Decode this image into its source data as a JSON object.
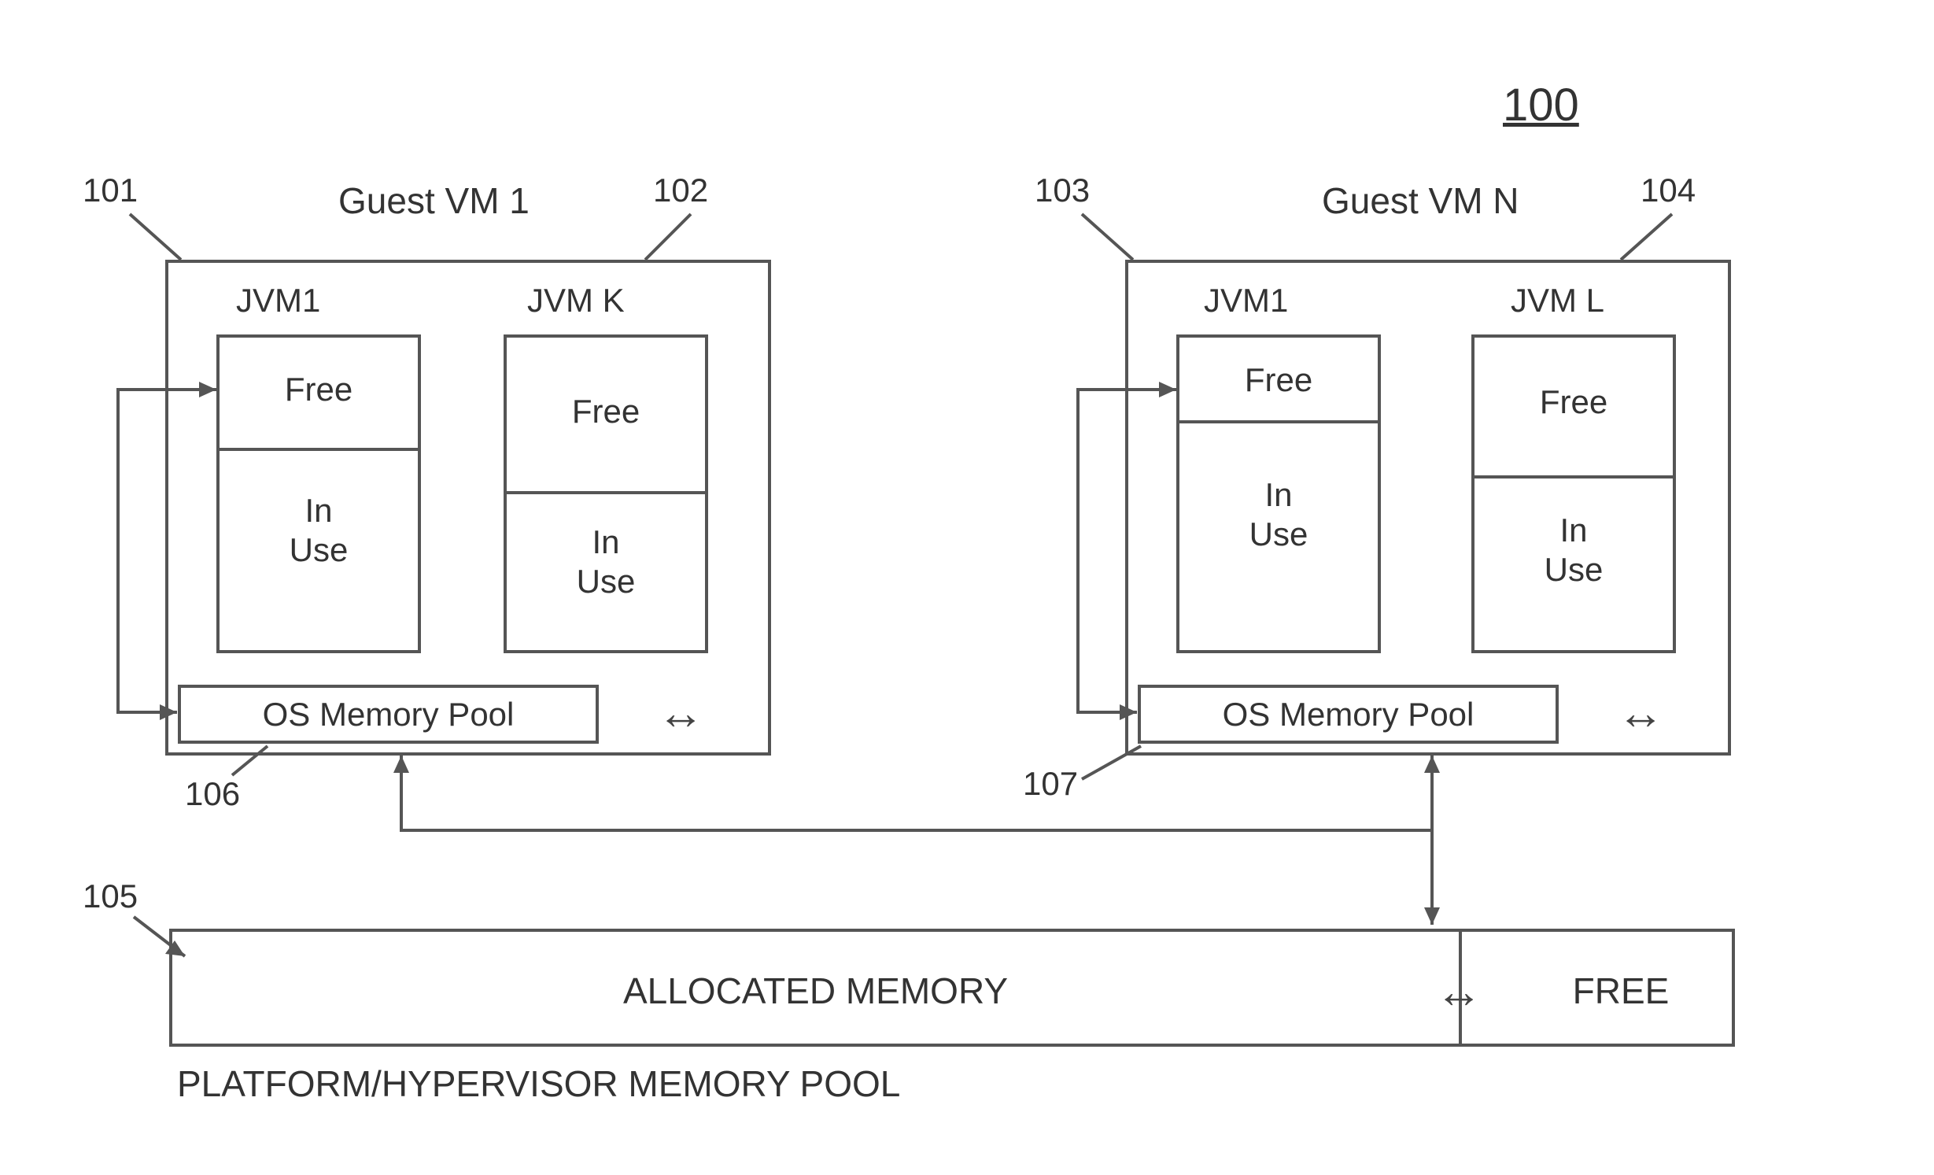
{
  "figure_number": "100",
  "vm1": {
    "title": "Guest VM 1",
    "ref_left": "101",
    "ref_right": "102",
    "jvm_a": {
      "label": "JVM1",
      "free": "Free",
      "inuse": "In\nUse"
    },
    "jvm_b": {
      "label": "JVM K",
      "free": "Free",
      "inuse": "In\nUse"
    },
    "os_pool": "OS Memory Pool",
    "os_ref": "106"
  },
  "vmN": {
    "title": "Guest VM N",
    "ref_left": "103",
    "ref_right": "104",
    "jvm_a": {
      "label": "JVM1",
      "free": "Free",
      "inuse": "In\nUse"
    },
    "jvm_b": {
      "label": "JVM L",
      "free": "Free",
      "inuse": "In\nUse"
    },
    "os_pool": "OS Memory Pool",
    "os_ref": "107"
  },
  "platform": {
    "ref": "105",
    "allocated": "ALLOCATED MEMORY",
    "free": "FREE",
    "caption": "PLATFORM/HYPERVISOR MEMORY POOL"
  }
}
